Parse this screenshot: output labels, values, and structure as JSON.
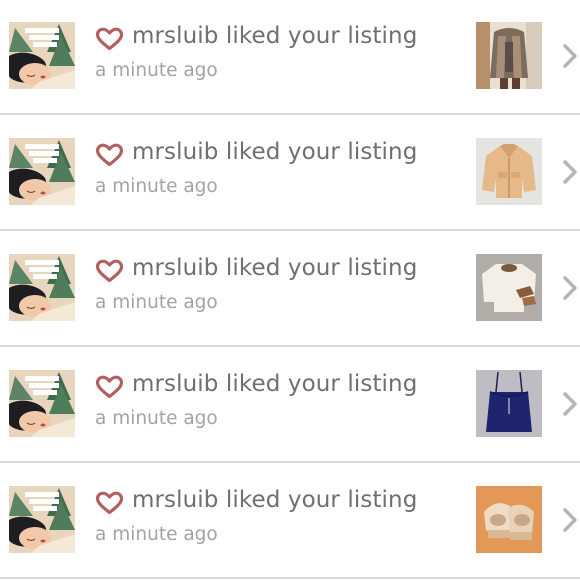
{
  "activity": {
    "items": [
      {
        "username": "mrsluib",
        "action": "liked your listing",
        "text": "mrsluib liked your listing",
        "time": "a minute ago",
        "thumbnail": "cardigan-outfit"
      },
      {
        "username": "mrsluib",
        "action": "liked your listing",
        "text": "mrsluib liked your listing",
        "time": "a minute ago",
        "thumbnail": "tan-jacket"
      },
      {
        "username": "mrsluib",
        "action": "liked your listing",
        "text": "mrsluib liked your listing",
        "time": "a minute ago",
        "thumbnail": "cream-sweater-set"
      },
      {
        "username": "mrsluib",
        "action": "liked your listing",
        "text": "mrsluib liked your listing",
        "time": "a minute ago",
        "thumbnail": "navy-camisole"
      },
      {
        "username": "mrsluib",
        "action": "liked your listing",
        "text": "mrsluib liked your listing",
        "time": "a minute ago",
        "thumbnail": "tan-wedge-shoes"
      }
    ]
  },
  "icons": {
    "like": "heart-outline-icon",
    "open": "chevron-right-icon"
  },
  "colors": {
    "heart": "#b2605f",
    "title_text": "#6f6f6f",
    "time_text": "#a3a3a3",
    "divider": "#d9d9d9",
    "chevron": "#b5b5b5"
  }
}
